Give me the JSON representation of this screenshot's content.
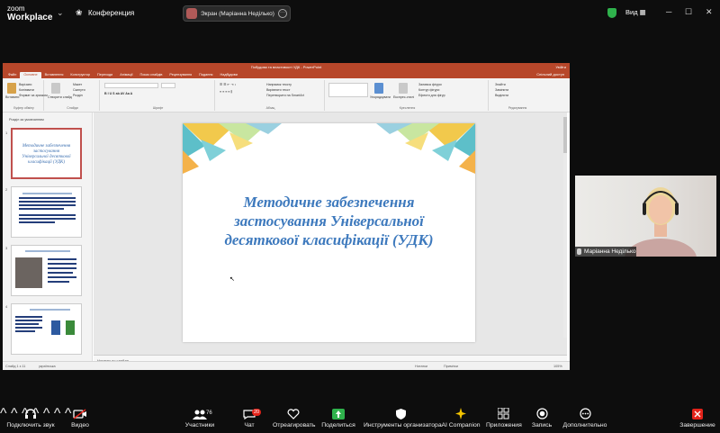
{
  "top": {
    "logo_line1": "zoom",
    "logo_line2": "Workplace",
    "conference": "Конференция",
    "screen_share": "Экран (Маріанна Неділько)",
    "view": "Вид",
    "win_min": "─",
    "win_max": "☐",
    "win_close": "✕",
    "shield_color": "#2fb24c"
  },
  "ppt": {
    "window_title": "Побудова та властивості УДК - PowerPoint",
    "title_right": "Увійти",
    "tabs": [
      "Файл",
      "Основне",
      "Вставлення",
      "Конструктор",
      "Переходи",
      "Анімації",
      "Показ слайдів",
      "Рецензування",
      "Подання",
      "Надбудови"
    ],
    "active_tab": "Основне",
    "share_right": "Спільний доступ",
    "ribbon": {
      "clipboard": "Буфер обміну",
      "paste": "Вставити",
      "cut": "Вирізати",
      "copy": "Копіювати",
      "format_painter": "Формат за зразком",
      "slides": "Слайди",
      "new_slide": "Створити слайд",
      "layout": "Макет",
      "reset": "Скинути",
      "section": "Розділ",
      "font": "Шрифт",
      "paragraph": "Абзац",
      "text_direction": "Напрямок тексту",
      "align_text": "Вирівняти текст",
      "smartart": "Перетворити на SmartArt",
      "drawing": "Креслення",
      "arrange": "Упорядкувати",
      "quick_styles": "Експрес-стилі",
      "shape_fill": "Заливка фігури",
      "shape_outline": "Контур фігури",
      "shape_effects": "Ефекти для фігур",
      "editing": "Редагування",
      "find": "Знайти",
      "replace": "Замінити",
      "select": "Виділити",
      "tellme": "Скажіть, що потрібно зробити"
    },
    "panel_header": "Розділ за умовчанням",
    "thumb1_text": "Методичне забезпечення застосування Універсальної десяткової класифікації (УДК)",
    "thumb_nums": [
      "1",
      "2",
      "3",
      "4"
    ],
    "slide_title": "Методичне забезпечення застосування Універсальної десяткової класифікації (УДК)",
    "notes": "Нотатки до слайда",
    "status": {
      "slide_of": "Слайд 1 з 11",
      "lang": "українська",
      "notes_btn": "Нотатки",
      "comments_btn": "Примітки",
      "zoom": "105%"
    }
  },
  "video": {
    "participant_name": "Маріанна Неділько"
  },
  "bottom": {
    "audio": "Подключить звук",
    "video": "Видео",
    "participants": "Участники",
    "participants_count": "76",
    "chat": "Чат",
    "chat_badge": "20",
    "react": "Отреагировать",
    "share": "Поделиться",
    "host_tools": "Инструменты организатора",
    "ai": "AI Companion",
    "apps": "Приложения",
    "record": "Запись",
    "more": "Дополнительно",
    "end": "Завершение"
  }
}
